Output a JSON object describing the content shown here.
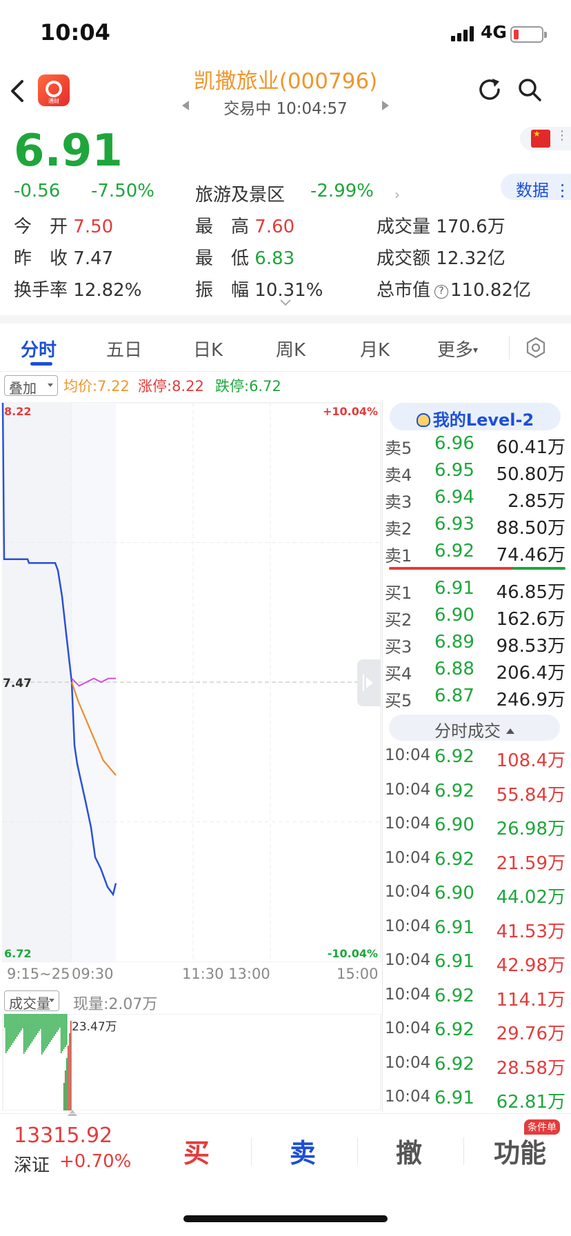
{
  "status": {
    "time": "10:04",
    "network": "4G"
  },
  "nav": {
    "title": "凯撒旅业(000796)",
    "subtitle": "交易中 10:04:57",
    "app_logo_text": "通财"
  },
  "quote": {
    "price": "6.91",
    "change": "-0.56",
    "change_pct": "-7.50%",
    "sector": "旅游及景区",
    "sector_change": "-2.99%",
    "data_btn": "数据",
    "stats": [
      {
        "label": "今　开",
        "value": "7.50",
        "tone": "red"
      },
      {
        "label": "最　高",
        "value": "7.60",
        "tone": "red"
      },
      {
        "label": "成交量",
        "value": "170.6万",
        "tone": "plain"
      },
      {
        "label": "昨　收",
        "value": "7.47",
        "tone": "plain"
      },
      {
        "label": "最　低",
        "value": "6.83",
        "tone": "green"
      },
      {
        "label": "成交额",
        "value": "12.32亿",
        "tone": "plain"
      },
      {
        "label": "换手率",
        "value": "12.82%",
        "tone": "plain"
      },
      {
        "label": "振　幅",
        "value": "10.31%",
        "tone": "plain"
      },
      {
        "label": "总市值",
        "value": "110.82亿",
        "tone": "plain"
      }
    ]
  },
  "tabs": [
    "分时",
    "五日",
    "日K",
    "周K",
    "月K",
    "更多"
  ],
  "overlay": {
    "pill": "叠加",
    "avg": "均价:7.22",
    "limit_up": "涨停:8.22",
    "limit_down": "跌停:6.72"
  },
  "chart_data": {
    "type": "line",
    "y_top": "8.22",
    "y_mid": "7.47",
    "y_bottom": "6.72",
    "pct_top": "+10.04%",
    "pct_bottom": "-10.04%",
    "ylim": [
      6.72,
      8.22
    ],
    "x_ticks": [
      "9:15~25",
      "09:30",
      "11:30 13:00",
      "15:00"
    ],
    "series": [
      {
        "values": [
          8.22,
          7.8,
          7.8,
          7.79,
          7.79,
          7.77,
          7.7,
          7.6,
          7.47,
          7.3,
          7.25,
          7.15,
          7.08,
          7.0,
          6.97,
          6.92,
          6.9,
          6.93
        ]
      },
      {
        "values": [
          7.47,
          7.42,
          7.38,
          7.34,
          7.3,
          7.26,
          7.24,
          7.22
        ]
      },
      {
        "values": [
          7.48,
          7.46,
          7.47,
          7.48,
          7.47,
          7.48,
          7.48
        ]
      }
    ],
    "volume_label": "成交量",
    "current_volume": "现量:2.07万",
    "volume_max": "23.47万"
  },
  "level2": {
    "title": "我的Level-2",
    "asks": [
      {
        "label": "卖5",
        "price": "6.96",
        "vol": "60.41万"
      },
      {
        "label": "卖4",
        "price": "6.95",
        "vol": "50.80万"
      },
      {
        "label": "卖3",
        "price": "6.94",
        "vol": "2.85万"
      },
      {
        "label": "卖2",
        "price": "6.93",
        "vol": "88.50万"
      },
      {
        "label": "卖1",
        "price": "6.92",
        "vol": "74.46万"
      }
    ],
    "bids": [
      {
        "label": "买1",
        "price": "6.91",
        "vol": "46.85万"
      },
      {
        "label": "买2",
        "price": "6.90",
        "vol": "162.6万"
      },
      {
        "label": "买3",
        "price": "6.89",
        "vol": "98.53万"
      },
      {
        "label": "买4",
        "price": "6.88",
        "vol": "206.4万"
      },
      {
        "label": "买5",
        "price": "6.87",
        "vol": "246.9万"
      }
    ],
    "trades_title": "分时成交",
    "trades": [
      {
        "time": "10:04",
        "price": "6.92",
        "vol": "108.4万",
        "side": "red"
      },
      {
        "time": "10:04",
        "price": "6.92",
        "vol": "55.84万",
        "side": "red"
      },
      {
        "time": "10:04",
        "price": "6.90",
        "vol": "26.98万",
        "side": "green"
      },
      {
        "time": "10:04",
        "price": "6.92",
        "vol": "21.59万",
        "side": "red"
      },
      {
        "time": "10:04",
        "price": "6.90",
        "vol": "44.02万",
        "side": "green"
      },
      {
        "time": "10:04",
        "price": "6.91",
        "vol": "41.53万",
        "side": "red"
      },
      {
        "time": "10:04",
        "price": "6.91",
        "vol": "42.98万",
        "side": "red"
      },
      {
        "time": "10:04",
        "price": "6.92",
        "vol": "114.1万",
        "side": "red"
      },
      {
        "time": "10:04",
        "price": "6.92",
        "vol": "29.76万",
        "side": "red"
      },
      {
        "time": "10:04",
        "price": "6.92",
        "vol": "28.58万",
        "side": "red"
      },
      {
        "time": "10:04",
        "price": "6.91",
        "vol": "62.81万",
        "side": "green"
      }
    ]
  },
  "bottom": {
    "index_value": "13315.92",
    "index_name": "深证",
    "index_change": "+0.70%",
    "buy": "买",
    "sell": "卖",
    "cancel": "撤",
    "func": "功能",
    "badge": "条件单"
  },
  "colors": {
    "up": "#e43b3b",
    "down": "#1ea63b",
    "accent": "#1c4fd6",
    "title": "#f0962c"
  }
}
